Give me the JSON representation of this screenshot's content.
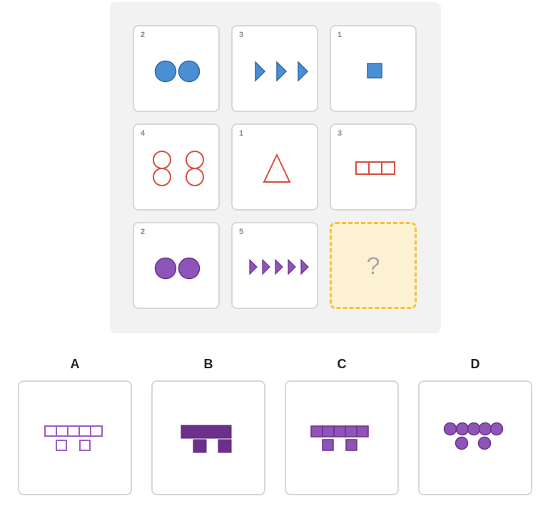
{
  "colors": {
    "blue": "#4a8fd4",
    "blue_stroke": "#2d6aa8",
    "red": "#d9503f",
    "purple": "#8e55b8",
    "purple_dark": "#6b2f8c",
    "option_outline_purple": "#9b5fc8",
    "missing_bg": "#fcf1d1",
    "missing_border": "#f1c43f"
  },
  "grid": {
    "cells": [
      {
        "count": "2",
        "shape": "circle-filled",
        "color": "blue"
      },
      {
        "count": "3",
        "shape": "triangle-right-filled",
        "color": "blue"
      },
      {
        "count": "1",
        "shape": "square-filled",
        "color": "blue"
      },
      {
        "count": "4",
        "shape": "circle-outline",
        "color": "red"
      },
      {
        "count": "1",
        "shape": "triangle-up-outline",
        "color": "red"
      },
      {
        "count": "3",
        "shape": "square-outline",
        "color": "red"
      },
      {
        "count": "2",
        "shape": "circle-filled",
        "color": "purple"
      },
      {
        "count": "5",
        "shape": "triangle-right-filled",
        "color": "purple"
      }
    ],
    "missing": {
      "symbol": "?"
    }
  },
  "options": [
    {
      "label": "A",
      "shape": "square-outline",
      "color": "purple"
    },
    {
      "label": "B",
      "shape": "square-filled",
      "color": "purple"
    },
    {
      "label": "C",
      "shape": "square-filled",
      "color": "purple"
    },
    {
      "label": "D",
      "shape": "circle-filled",
      "color": "purple"
    }
  ]
}
